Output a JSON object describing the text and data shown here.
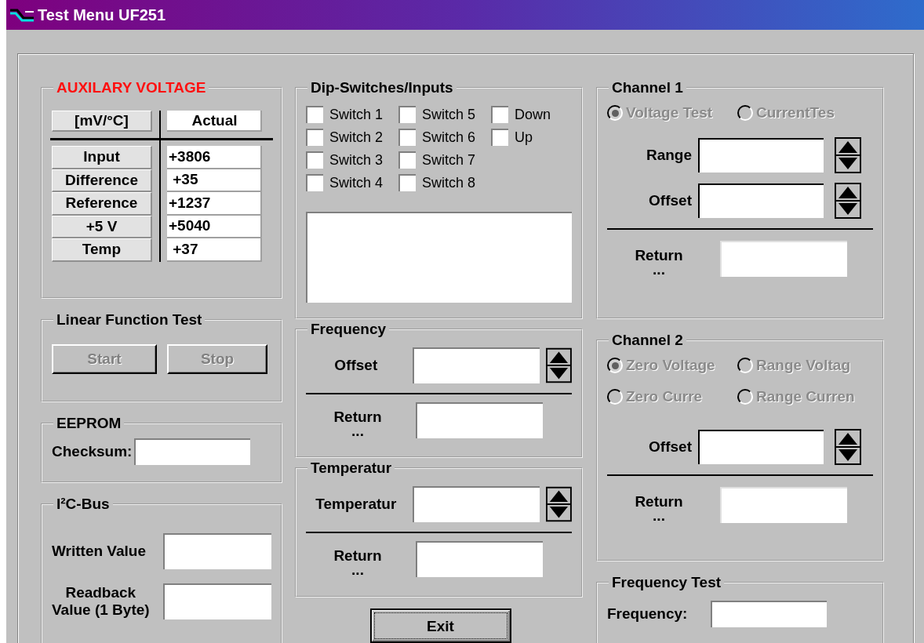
{
  "window": {
    "title": "Test Menu UF251"
  },
  "auxiliary_voltage": {
    "title": "AUXILARY VOLTAGE",
    "headers": [
      "[mV/°C]",
      "Actual"
    ],
    "rows": [
      {
        "label": "Input",
        "value": "+3806"
      },
      {
        "label": "Difference",
        "value": " +35"
      },
      {
        "label": "Reference",
        "value": "+1237"
      },
      {
        "label": "+5 V",
        "value": "+5040"
      },
      {
        "label": "Temp",
        "value": " +37"
      }
    ]
  },
  "linear_function_test": {
    "title": "Linear Function Test",
    "buttons": [
      {
        "label": "Start",
        "disabled": true
      },
      {
        "label": "Stop",
        "disabled": true
      }
    ]
  },
  "eeprom": {
    "title": "EEPROM",
    "fields": [
      {
        "label": "Checksum:",
        "spinner": false
      }
    ]
  },
  "i2c_bus": {
    "title": "I²C-Bus",
    "fields": [
      {
        "label": "Written Value",
        "spinner": false
      },
      {
        "label": "Readback\nValue (1 Byte)",
        "spinner": false
      }
    ]
  },
  "dip_switches": {
    "title": "Dip-Switches/Inputs",
    "columns": [
      [
        {
          "label": "Switch 1",
          "checked": false
        },
        {
          "label": "Switch 2",
          "checked": false
        },
        {
          "label": "Switch 3",
          "checked": false
        },
        {
          "label": "Switch 4",
          "checked": false
        }
      ],
      [
        {
          "label": "Switch 5",
          "checked": false
        },
        {
          "label": "Switch 6",
          "checked": false
        },
        {
          "label": "Switch 7",
          "checked": false
        },
        {
          "label": "Switch 8",
          "checked": false
        }
      ],
      [
        {
          "label": "Down",
          "checked": false
        },
        {
          "label": "Up",
          "checked": false
        }
      ]
    ]
  },
  "frequency": {
    "title": "Frequency",
    "fields": [
      {
        "label": "Offset",
        "spinner": true
      }
    ],
    "readback": {
      "label": "Return ..."
    }
  },
  "temperatur": {
    "title": "Temperatur",
    "fields": [
      {
        "label": "Temperatur",
        "spinner": true
      }
    ],
    "readback": {
      "label": "Return ..."
    }
  },
  "exit_button": {
    "label": "Exit",
    "disabled": false
  },
  "channel_1": {
    "title": "Channel 1",
    "radios": [
      [
        {
          "label": "Voltage Test",
          "selected": true,
          "disabled": true
        },
        {
          "label": "CurrentTes",
          "selected": false,
          "disabled": true
        }
      ]
    ],
    "fields": [
      {
        "label": "Range",
        "spinner": true
      },
      {
        "label": "Offset",
        "spinner": true
      }
    ],
    "readback": {
      "label": "Return ..."
    }
  },
  "channel_2": {
    "title": "Channel 2",
    "radios": [
      [
        {
          "label": "Zero Voltage",
          "selected": true,
          "disabled": true
        },
        {
          "label": "Range Voltag",
          "selected": false,
          "disabled": true
        }
      ],
      [
        {
          "label": "Zero Curre",
          "selected": false,
          "disabled": true
        },
        {
          "label": "Range Curren",
          "selected": false,
          "disabled": true
        }
      ]
    ],
    "fields": [
      {
        "label": "Offset",
        "spinner": true
      }
    ],
    "readback": {
      "label": "Return ..."
    }
  },
  "frequency_test": {
    "title": "Frequency Test",
    "fields": [
      {
        "label": "Frequency:",
        "spinner": false
      }
    ]
  }
}
